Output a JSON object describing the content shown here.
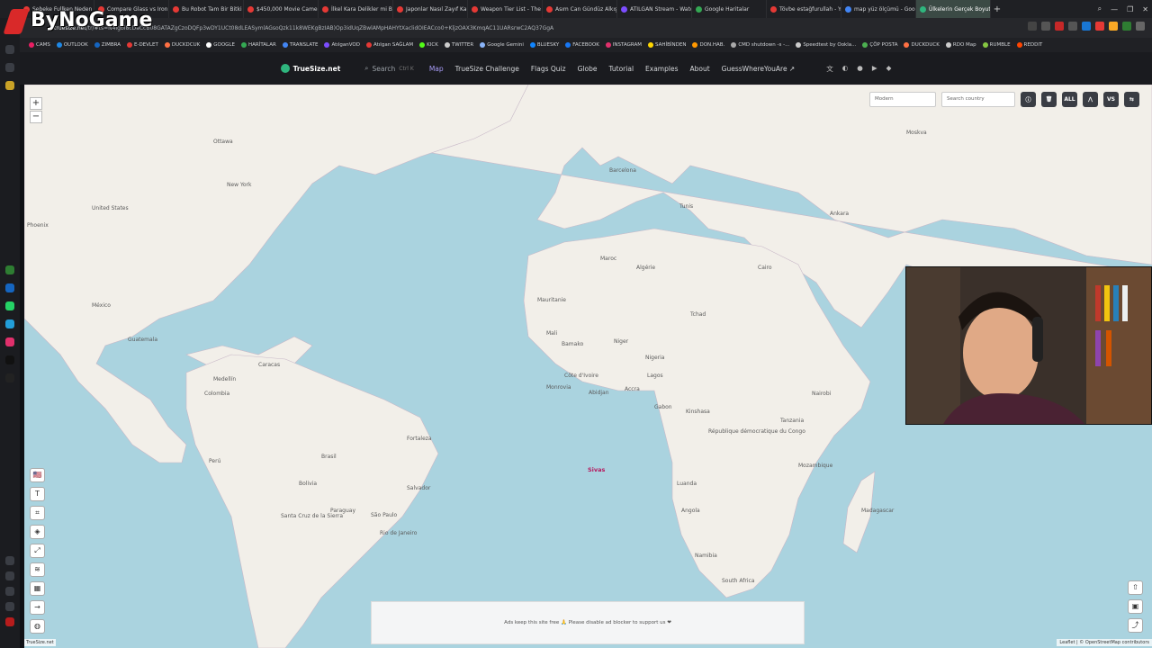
{
  "logo": {
    "text": "ByNoGame"
  },
  "tabs": [
    {
      "label": "Şebeke Fullken Neden İnt...",
      "color": "#e53935"
    },
    {
      "label": "Compare Glass vs Iron - Y",
      "color": "#e53935"
    },
    {
      "label": "Bu Robot Tam Bir Bitki Gib",
      "color": "#e53935"
    },
    {
      "label": "$450,000 Movie Camera",
      "color": "#e53935"
    },
    {
      "label": "İlkel Kara Delikler mi Bulu",
      "color": "#e53935"
    },
    {
      "label": "Japonlar Nasıl Zayıf Kalıyo",
      "color": "#e53935"
    },
    {
      "label": "Weapon Tier List - The Fin",
      "color": "#e53935"
    },
    {
      "label": "Asım Can Gündüz Alkışla",
      "color": "#e53935"
    },
    {
      "label": "ATILGAN Stream - Watch",
      "color": "#7c4dff"
    },
    {
      "label": "Google Haritalar",
      "color": "#34a853"
    },
    {
      "label": "Tövbe estağfurullah - You",
      "color": "#e53935"
    },
    {
      "label": "map yüz ölçümü - Google",
      "color": "#4285f4"
    },
    {
      "label": "Ülkelerin Gerçek Boyutlar",
      "color": "#2fb67e",
      "active": true
    }
  ],
  "new_tab": "+",
  "window_controls": [
    "⌕",
    "—",
    "❐",
    "✕"
  ],
  "address": {
    "domain": "truesize.net",
    "path": "/tr/#ts=N4Igbi8cDaCcB08GATAZgCzoDQFp3wDY1UCt08dLEASymlAGsoQzk11k8WEKgBzIAB)Op3idUqZBwlAMpHAHYtXaclidOIEACco0+KljzOAX3KmqAC11UARsrwC2AQ37GgA"
  },
  "bookmarks": [
    {
      "label": "CAMS",
      "color": "#e91e63"
    },
    {
      "label": "OUTLOOK",
      "color": "#1e88e5"
    },
    {
      "label": "ZIMBRA",
      "color": "#1565c0"
    },
    {
      "label": "E-DEVLET",
      "color": "#e53935"
    },
    {
      "label": "DUCKDCUK",
      "color": "#ff7043"
    },
    {
      "label": "GOOGLE",
      "color": "#ffffff"
    },
    {
      "label": "HARİTALAR",
      "color": "#34a853"
    },
    {
      "label": "TRANSLATE",
      "color": "#4285f4"
    },
    {
      "label": "AtılganVOD",
      "color": "#7c4dff"
    },
    {
      "label": "Atılgan SAĞLAM",
      "color": "#e53935"
    },
    {
      "label": "KICK",
      "color": "#53fc18"
    },
    {
      "label": "TWITTER",
      "color": "#cccccc"
    },
    {
      "label": "Google Gemini",
      "color": "#8ab4f8"
    },
    {
      "label": "BLUESKY",
      "color": "#1185fe"
    },
    {
      "label": "FACEBOOK",
      "color": "#1877f2"
    },
    {
      "label": "INSTAGRAM",
      "color": "#e1306c"
    },
    {
      "label": "SAHİBİNDEN",
      "color": "#ffd600"
    },
    {
      "label": "DON.HAB.",
      "color": "#ff9800"
    },
    {
      "label": "CMD shutdown -s -...",
      "color": "#aaaaaa"
    },
    {
      "label": "Speedtest by Ookla...",
      "color": "#cccccc"
    },
    {
      "label": "ÇÖP POSTA",
      "color": "#4caf50"
    },
    {
      "label": "DUCKDUCK",
      "color": "#ff7043"
    },
    {
      "label": "RDO Map",
      "color": "#cccccc"
    },
    {
      "label": "RUMBLE",
      "color": "#85c742"
    },
    {
      "label": "REDDIT",
      "color": "#ff4500"
    }
  ],
  "site_nav": {
    "brand": "TrueSize.net",
    "search_label": "Search",
    "search_kbd": "Ctrl K",
    "items": [
      "Map",
      "TrueSize Challenge",
      "Flags Quiz",
      "Globe",
      "Tutorial",
      "Examples",
      "About",
      "GuessWhereYouAre ↗"
    ],
    "active": "Map"
  },
  "map_controls": {
    "projection_select": "Modern",
    "search_country_placeholder": "Search country",
    "btn_all": "ALL",
    "btn_vs": "VS",
    "zoom_in": "+",
    "zoom_out": "−"
  },
  "map_labels": [
    {
      "text": "Ottawa"
    },
    {
      "text": "New York"
    },
    {
      "text": "United States"
    },
    {
      "text": "Phoenix"
    },
    {
      "text": "México"
    },
    {
      "text": "Guatemala"
    },
    {
      "text": "Caracas"
    },
    {
      "text": "Colombia"
    },
    {
      "text": "Medellín"
    },
    {
      "text": "Perú"
    },
    {
      "text": "Bolivia"
    },
    {
      "text": "Brasil"
    },
    {
      "text": "São Paulo"
    },
    {
      "text": "Rio de Janeiro"
    },
    {
      "text": "Salvador"
    },
    {
      "text": "Fortaleza"
    },
    {
      "text": "Paraguay"
    },
    {
      "text": "Santa Cruz de la Sierra"
    },
    {
      "text": "Barcelona"
    },
    {
      "text": "Tunis"
    },
    {
      "text": "Algérie"
    },
    {
      "text": "Maroc"
    },
    {
      "text": "Mauritanie"
    },
    {
      "text": "Mali"
    },
    {
      "text": "Niger"
    },
    {
      "text": "Bamako"
    },
    {
      "text": "Nigeria"
    },
    {
      "text": "Tchad"
    },
    {
      "text": "Lagos"
    },
    {
      "text": "Accra"
    },
    {
      "text": "Abidjan"
    },
    {
      "text": "Monrovia"
    },
    {
      "text": "Côte d'Ivoire"
    },
    {
      "text": "Luanda"
    },
    {
      "text": "Angola"
    },
    {
      "text": "Namibia"
    },
    {
      "text": "South Africa"
    },
    {
      "text": "Gabon"
    },
    {
      "text": "République démocratique du Congo"
    },
    {
      "text": "Tanzania"
    },
    {
      "text": "Mozambique"
    },
    {
      "text": "Madagascar"
    },
    {
      "text": "Kinshasa"
    },
    {
      "text": "Nairobi"
    },
    {
      "text": "Cairo"
    },
    {
      "text": "Ankara"
    },
    {
      "text": "Moskva"
    }
  ],
  "focus_city": "Sivas",
  "tools_left": [
    "🇺🇸",
    "T",
    "⌗",
    "◈",
    "⤢",
    "≋",
    "▦",
    "→",
    "◍"
  ],
  "tools_right": [
    "⇧",
    "▣",
    "⤴"
  ],
  "ad_text": "Ads keep this site free 🙏 Please disable ad blocker to support us ❤",
  "attribution": "Leaflet | © OpenStreetMap contributors",
  "footer_brand": "TrueSize.net"
}
